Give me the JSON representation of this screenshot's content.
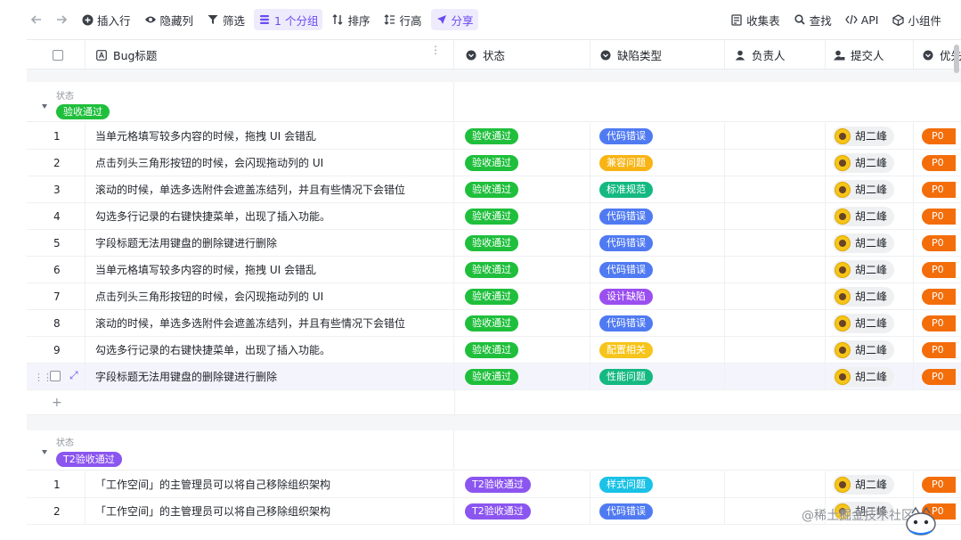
{
  "toolbar": {
    "left_items": [
      {
        "label": "插入行",
        "icon": "plus-circle-icon"
      },
      {
        "label": "隐藏列",
        "icon": "eye-icon"
      },
      {
        "label": "筛选",
        "icon": "filter-icon"
      },
      {
        "label": "1 个分组",
        "icon": "group-icon",
        "active": true
      },
      {
        "label": "排序",
        "icon": "sort-icon"
      },
      {
        "label": "行高",
        "icon": "row-height-icon"
      },
      {
        "label": "分享",
        "icon": "share-icon",
        "active": true
      }
    ],
    "right_items": [
      {
        "label": "收集表",
        "icon": "form-icon"
      },
      {
        "label": "查找",
        "icon": "search-icon"
      },
      {
        "label": "API",
        "icon": "code-icon"
      },
      {
        "label": "小组件",
        "icon": "widget-icon"
      }
    ]
  },
  "columns": {
    "title": "Bug标题",
    "status": "状态",
    "defect_type": "缺陷类型",
    "owner": "负责人",
    "submitter": "提交人",
    "priority": "优先"
  },
  "colors": {
    "accent": "#6b4cf0",
    "green": "#1fbf3c",
    "purple": "#8b55f0",
    "blue": "#4f7af2",
    "orange_yellow": "#f8b414",
    "teal": "#14b981",
    "violet": "#9b4ff0",
    "yellow": "#f6c41a",
    "cyan": "#19c2e6",
    "priority": "#f36d0a"
  },
  "groups": [
    {
      "field_label": "状态",
      "tag": "验收通过",
      "rows": [
        {
          "num": "1",
          "title": "当单元格填写较多内容的时候，拖拽 UI 会错乱",
          "status": "验收通过",
          "defect": "代码错误",
          "submitter": "胡二峰",
          "priority": "P0"
        },
        {
          "num": "2",
          "title": "点击列头三角形按钮的时候，会闪现拖动列的 UI",
          "status": "验收通过",
          "defect": "兼容问题",
          "submitter": "胡二峰",
          "priority": "P0"
        },
        {
          "num": "3",
          "title": "滚动的时候，单选多选附件会遮盖冻结列，并且有些情况下会错位",
          "status": "验收通过",
          "defect": "标准规范",
          "submitter": "胡二峰",
          "priority": "P0"
        },
        {
          "num": "4",
          "title": "勾选多行记录的右键快捷菜单，出现了插入功能。",
          "status": "验收通过",
          "defect": "代码错误",
          "submitter": "胡二峰",
          "priority": "P0"
        },
        {
          "num": "5",
          "title": "字段标题无法用键盘的删除键进行删除",
          "status": "验收通过",
          "defect": "代码错误",
          "submitter": "胡二峰",
          "priority": "P0"
        },
        {
          "num": "6",
          "title": "当单元格填写较多内容的时候，拖拽 UI 会错乱",
          "status": "验收通过",
          "defect": "代码错误",
          "submitter": "胡二峰",
          "priority": "P0"
        },
        {
          "num": "7",
          "title": "点击列头三角形按钮的时候，会闪现拖动列的 UI",
          "status": "验收通过",
          "defect": "设计缺陷",
          "submitter": "胡二峰",
          "priority": "P0"
        },
        {
          "num": "8",
          "title": "滚动的时候，单选多选附件会遮盖冻结列，并且有些情况下会错位",
          "status": "验收通过",
          "defect": "代码错误",
          "submitter": "胡二峰",
          "priority": "P0"
        },
        {
          "num": "9",
          "title": "勾选多行记录的右键快捷菜单，出现了插入功能。",
          "status": "验收通过",
          "defect": "配置相关",
          "submitter": "胡二峰",
          "priority": "P0"
        },
        {
          "num": "",
          "title": "字段标题无法用键盘的删除键进行删除",
          "status": "验收通过",
          "defect": "性能问题",
          "submitter": "胡二峰",
          "priority": "P0"
        }
      ]
    },
    {
      "field_label": "状态",
      "tag": "T2验收通过",
      "rows": [
        {
          "num": "1",
          "title": "「工作空间」的主管理员可以将自己移除组织架构",
          "status": "T2验收通过",
          "defect": "样式问题",
          "submitter": "胡二峰",
          "priority": "P0"
        },
        {
          "num": "2",
          "title": "「工作空间」的主管理员可以将自己移除组织架构",
          "status": "T2验收通过",
          "defect": "代码错误",
          "submitter": "胡二峰",
          "priority": "P0"
        }
      ]
    }
  ],
  "add_row_label": "+",
  "watermark": "@稀土掘金技术社区"
}
